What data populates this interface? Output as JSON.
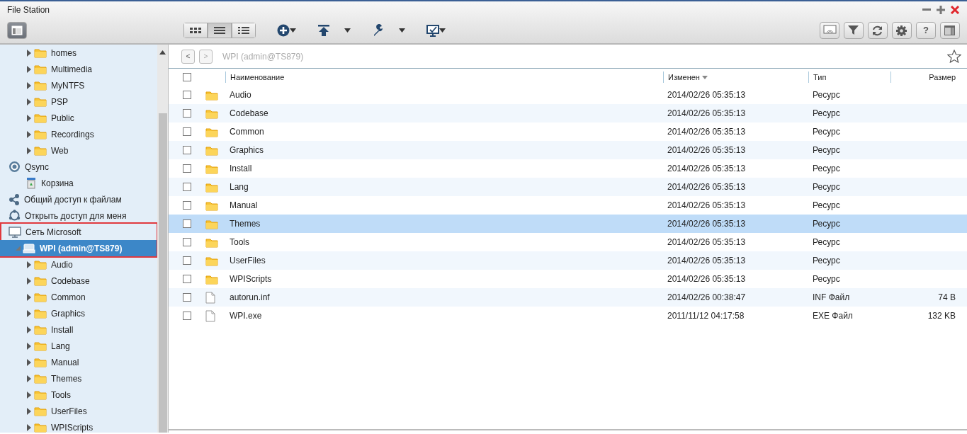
{
  "window": {
    "title": "File Station"
  },
  "toolbar": {
    "view_modes": [
      {
        "kind": "thumbnails",
        "selected": false
      },
      {
        "kind": "list",
        "selected": true
      },
      {
        "kind": "details",
        "selected": false
      }
    ],
    "menus": [
      {
        "kind": "add"
      },
      {
        "kind": "upload"
      },
      {
        "kind": "tools"
      },
      {
        "kind": "remote"
      }
    ],
    "right_buttons": [
      {
        "kind": "cast"
      },
      {
        "kind": "filter"
      },
      {
        "kind": "refresh"
      },
      {
        "kind": "settings"
      },
      {
        "kind": "help",
        "text": "?"
      },
      {
        "kind": "layout"
      }
    ]
  },
  "sidebar": {
    "upper_folders": [
      {
        "kind": "folder",
        "label": "homes",
        "expanded": false
      },
      {
        "kind": "folder",
        "label": "Multimedia",
        "expanded": false
      },
      {
        "kind": "folder",
        "label": "MyNTFS",
        "expanded": false
      },
      {
        "kind": "folder",
        "label": "PSP",
        "expanded": false
      },
      {
        "kind": "folder",
        "label": "Public",
        "expanded": false
      },
      {
        "kind": "folder",
        "label": "Recordings",
        "expanded": false
      },
      {
        "kind": "folder",
        "label": "Web",
        "expanded": false
      }
    ],
    "tree": [
      {
        "kind": "qsync",
        "label": "Qsync",
        "marked": false,
        "selected": false,
        "children": [
          {
            "kind": "recycle",
            "label": "Корзина",
            "marked": false,
            "selected": false
          }
        ]
      },
      {
        "kind": "share",
        "label": "Общий доступ к файлам",
        "marked": false,
        "selected": false
      },
      {
        "kind": "shared",
        "label": "Открыть доступ для меня",
        "marked": false,
        "selected": false
      },
      {
        "kind": "network",
        "label": "Сеть Microsoft",
        "marked": true,
        "selected": false,
        "children": [
          {
            "kind": "drive",
            "label": "WPI (admin@TS879)",
            "marked": true,
            "selected": true,
            "expanded": true,
            "children": [
              {
                "kind": "folder",
                "label": "Audio",
                "expanded": false,
                "marked": false,
                "selected": false
              },
              {
                "kind": "folder",
                "label": "Codebase",
                "expanded": false,
                "marked": false,
                "selected": false
              },
              {
                "kind": "folder",
                "label": "Common",
                "expanded": false,
                "marked": false,
                "selected": false
              },
              {
                "kind": "folder",
                "label": "Graphics",
                "expanded": false,
                "marked": false,
                "selected": false
              },
              {
                "kind": "folder",
                "label": "Install",
                "expanded": false,
                "marked": false,
                "selected": false
              },
              {
                "kind": "folder",
                "label": "Lang",
                "expanded": false,
                "marked": false,
                "selected": false
              },
              {
                "kind": "folder",
                "label": "Manual",
                "expanded": false,
                "marked": false,
                "selected": false
              },
              {
                "kind": "folder",
                "label": "Themes",
                "expanded": false,
                "marked": false,
                "selected": false
              },
              {
                "kind": "folder",
                "label": "Tools",
                "expanded": false,
                "marked": false,
                "selected": false
              },
              {
                "kind": "folder",
                "label": "UserFiles",
                "expanded": false,
                "marked": false,
                "selected": false
              },
              {
                "kind": "folder",
                "label": "WPIScripts",
                "expanded": false,
                "marked": false,
                "selected": false
              }
            ]
          }
        ]
      }
    ]
  },
  "breadcrumb": {
    "back": "<",
    "forward": ">",
    "path": "WPI (admin@TS879)"
  },
  "table": {
    "select_all_checked": false,
    "columns": [
      {
        "label": "Наименование",
        "sorted": false
      },
      {
        "label": "Изменен",
        "sorted": true
      },
      {
        "label": "Тип",
        "sorted": false
      },
      {
        "label": "Размер",
        "sorted": false
      }
    ],
    "rows": [
      {
        "kind": "folder",
        "name": "Audio",
        "modified": "2014/02/26 05:35:13",
        "type": "Ресурс",
        "checked": false,
        "selected": false
      },
      {
        "kind": "folder",
        "name": "Codebase",
        "modified": "2014/02/26 05:35:13",
        "type": "Ресурс",
        "checked": false,
        "selected": false
      },
      {
        "kind": "folder",
        "name": "Common",
        "modified": "2014/02/26 05:35:13",
        "type": "Ресурс",
        "checked": false,
        "selected": false
      },
      {
        "kind": "folder",
        "name": "Graphics",
        "modified": "2014/02/26 05:35:13",
        "type": "Ресурс",
        "checked": false,
        "selected": false
      },
      {
        "kind": "folder",
        "name": "Install",
        "modified": "2014/02/26 05:35:13",
        "type": "Ресурс",
        "checked": false,
        "selected": false
      },
      {
        "kind": "folder",
        "name": "Lang",
        "modified": "2014/02/26 05:35:13",
        "type": "Ресурс",
        "checked": false,
        "selected": false
      },
      {
        "kind": "folder",
        "name": "Manual",
        "modified": "2014/02/26 05:35:13",
        "type": "Ресурс",
        "checked": false,
        "selected": false
      },
      {
        "kind": "folder",
        "name": "Themes",
        "modified": "2014/02/26 05:35:13",
        "type": "Ресурс",
        "checked": false,
        "selected": true
      },
      {
        "kind": "folder",
        "name": "Tools",
        "modified": "2014/02/26 05:35:13",
        "type": "Ресурс",
        "checked": false,
        "selected": false
      },
      {
        "kind": "folder",
        "name": "UserFiles",
        "modified": "2014/02/26 05:35:13",
        "type": "Ресурс",
        "checked": false,
        "selected": false
      },
      {
        "kind": "folder",
        "name": "WPIScripts",
        "modified": "2014/02/26 05:35:13",
        "type": "Ресурс",
        "checked": false,
        "selected": false
      },
      {
        "kind": "file",
        "name": "autorun.inf",
        "modified": "2014/02/26 00:38:47",
        "type": "INF Файл",
        "size": "74 B",
        "checked": false,
        "selected": false
      },
      {
        "kind": "file",
        "name": "WPI.exe",
        "modified": "2011/11/12 04:17:58",
        "type": "EXE Файл",
        "size": "132 KB",
        "checked": false,
        "selected": false
      }
    ]
  }
}
